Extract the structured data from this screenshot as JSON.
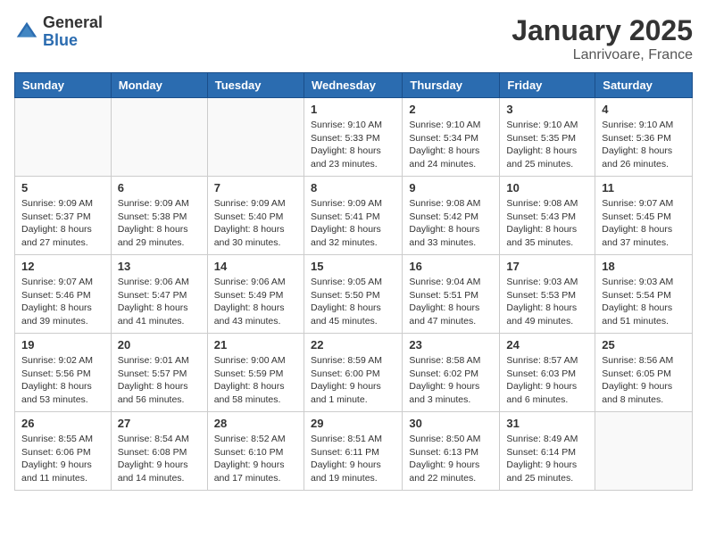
{
  "logo": {
    "general": "General",
    "blue": "Blue"
  },
  "title": "January 2025",
  "location": "Lanrivoare, France",
  "days": [
    "Sunday",
    "Monday",
    "Tuesday",
    "Wednesday",
    "Thursday",
    "Friday",
    "Saturday"
  ],
  "weeks": [
    [
      {
        "day": "",
        "content": ""
      },
      {
        "day": "",
        "content": ""
      },
      {
        "day": "",
        "content": ""
      },
      {
        "day": "1",
        "content": "Sunrise: 9:10 AM\nSunset: 5:33 PM\nDaylight: 8 hours\nand 23 minutes."
      },
      {
        "day": "2",
        "content": "Sunrise: 9:10 AM\nSunset: 5:34 PM\nDaylight: 8 hours\nand 24 minutes."
      },
      {
        "day": "3",
        "content": "Sunrise: 9:10 AM\nSunset: 5:35 PM\nDaylight: 8 hours\nand 25 minutes."
      },
      {
        "day": "4",
        "content": "Sunrise: 9:10 AM\nSunset: 5:36 PM\nDaylight: 8 hours\nand 26 minutes."
      }
    ],
    [
      {
        "day": "5",
        "content": "Sunrise: 9:09 AM\nSunset: 5:37 PM\nDaylight: 8 hours\nand 27 minutes."
      },
      {
        "day": "6",
        "content": "Sunrise: 9:09 AM\nSunset: 5:38 PM\nDaylight: 8 hours\nand 29 minutes."
      },
      {
        "day": "7",
        "content": "Sunrise: 9:09 AM\nSunset: 5:40 PM\nDaylight: 8 hours\nand 30 minutes."
      },
      {
        "day": "8",
        "content": "Sunrise: 9:09 AM\nSunset: 5:41 PM\nDaylight: 8 hours\nand 32 minutes."
      },
      {
        "day": "9",
        "content": "Sunrise: 9:08 AM\nSunset: 5:42 PM\nDaylight: 8 hours\nand 33 minutes."
      },
      {
        "day": "10",
        "content": "Sunrise: 9:08 AM\nSunset: 5:43 PM\nDaylight: 8 hours\nand 35 minutes."
      },
      {
        "day": "11",
        "content": "Sunrise: 9:07 AM\nSunset: 5:45 PM\nDaylight: 8 hours\nand 37 minutes."
      }
    ],
    [
      {
        "day": "12",
        "content": "Sunrise: 9:07 AM\nSunset: 5:46 PM\nDaylight: 8 hours\nand 39 minutes."
      },
      {
        "day": "13",
        "content": "Sunrise: 9:06 AM\nSunset: 5:47 PM\nDaylight: 8 hours\nand 41 minutes."
      },
      {
        "day": "14",
        "content": "Sunrise: 9:06 AM\nSunset: 5:49 PM\nDaylight: 8 hours\nand 43 minutes."
      },
      {
        "day": "15",
        "content": "Sunrise: 9:05 AM\nSunset: 5:50 PM\nDaylight: 8 hours\nand 45 minutes."
      },
      {
        "day": "16",
        "content": "Sunrise: 9:04 AM\nSunset: 5:51 PM\nDaylight: 8 hours\nand 47 minutes."
      },
      {
        "day": "17",
        "content": "Sunrise: 9:03 AM\nSunset: 5:53 PM\nDaylight: 8 hours\nand 49 minutes."
      },
      {
        "day": "18",
        "content": "Sunrise: 9:03 AM\nSunset: 5:54 PM\nDaylight: 8 hours\nand 51 minutes."
      }
    ],
    [
      {
        "day": "19",
        "content": "Sunrise: 9:02 AM\nSunset: 5:56 PM\nDaylight: 8 hours\nand 53 minutes."
      },
      {
        "day": "20",
        "content": "Sunrise: 9:01 AM\nSunset: 5:57 PM\nDaylight: 8 hours\nand 56 minutes."
      },
      {
        "day": "21",
        "content": "Sunrise: 9:00 AM\nSunset: 5:59 PM\nDaylight: 8 hours\nand 58 minutes."
      },
      {
        "day": "22",
        "content": "Sunrise: 8:59 AM\nSunset: 6:00 PM\nDaylight: 9 hours\nand 1 minute."
      },
      {
        "day": "23",
        "content": "Sunrise: 8:58 AM\nSunset: 6:02 PM\nDaylight: 9 hours\nand 3 minutes."
      },
      {
        "day": "24",
        "content": "Sunrise: 8:57 AM\nSunset: 6:03 PM\nDaylight: 9 hours\nand 6 minutes."
      },
      {
        "day": "25",
        "content": "Sunrise: 8:56 AM\nSunset: 6:05 PM\nDaylight: 9 hours\nand 8 minutes."
      }
    ],
    [
      {
        "day": "26",
        "content": "Sunrise: 8:55 AM\nSunset: 6:06 PM\nDaylight: 9 hours\nand 11 minutes."
      },
      {
        "day": "27",
        "content": "Sunrise: 8:54 AM\nSunset: 6:08 PM\nDaylight: 9 hours\nand 14 minutes."
      },
      {
        "day": "28",
        "content": "Sunrise: 8:52 AM\nSunset: 6:10 PM\nDaylight: 9 hours\nand 17 minutes."
      },
      {
        "day": "29",
        "content": "Sunrise: 8:51 AM\nSunset: 6:11 PM\nDaylight: 9 hours\nand 19 minutes."
      },
      {
        "day": "30",
        "content": "Sunrise: 8:50 AM\nSunset: 6:13 PM\nDaylight: 9 hours\nand 22 minutes."
      },
      {
        "day": "31",
        "content": "Sunrise: 8:49 AM\nSunset: 6:14 PM\nDaylight: 9 hours\nand 25 minutes."
      },
      {
        "day": "",
        "content": ""
      }
    ]
  ]
}
